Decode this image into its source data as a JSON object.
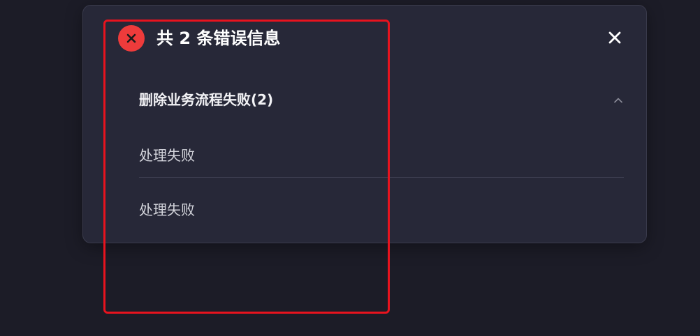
{
  "dialog": {
    "title": "共 2 条错误信息",
    "header_icon": "error-circle-icon",
    "close_icon": "close-icon",
    "colors": {
      "error_icon": "#ee3b3b",
      "dialog_background": "#272838",
      "page_background": "#1c1c27",
      "highlight_border": "#e8131e"
    },
    "group": {
      "title": "删除业务流程失败(2)",
      "expanded": true,
      "toggle_icon": "chevron-up-icon",
      "items": [
        {
          "text": "处理失败"
        },
        {
          "text": "处理失败"
        }
      ]
    }
  }
}
